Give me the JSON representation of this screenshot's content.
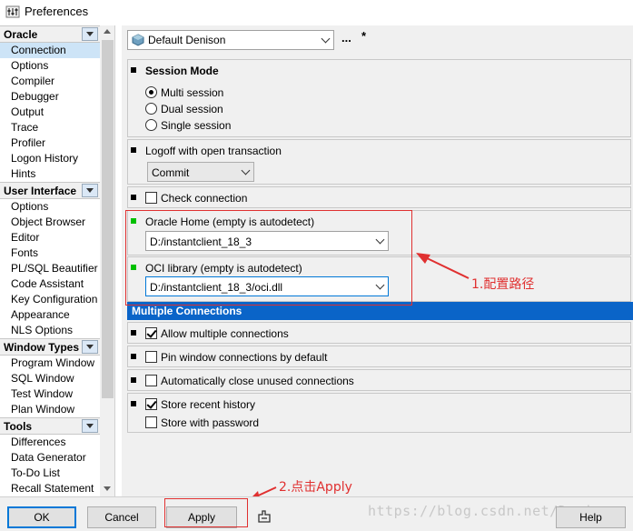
{
  "window": {
    "title": "Preferences"
  },
  "tree": {
    "groups": [
      {
        "label": "Oracle",
        "items": [
          "Connection",
          "Options",
          "Compiler",
          "Debugger",
          "Output",
          "Trace",
          "Profiler",
          "Logon History",
          "Hints"
        ]
      },
      {
        "label": "User Interface",
        "items": [
          "Options",
          "Object Browser",
          "Editor",
          "Fonts",
          "PL/SQL Beautifier",
          "Code Assistant",
          "Key Configuration",
          "Appearance",
          "NLS Options"
        ]
      },
      {
        "label": "Window Types",
        "items": [
          "Program Window",
          "SQL Window",
          "Test Window",
          "Plan Window"
        ]
      },
      {
        "label": "Tools",
        "items": [
          "Differences",
          "Data Generator",
          "To-Do List",
          "Recall Statement"
        ]
      }
    ],
    "selected": "Connection"
  },
  "top": {
    "preference_set": "Default Denison",
    "dots": "...",
    "star": "*"
  },
  "session": {
    "title": "Session Mode",
    "options": [
      "Multi session",
      "Dual session",
      "Single session"
    ],
    "selected": "Multi session"
  },
  "logoff": {
    "title": "Logoff with open transaction",
    "value": "Commit"
  },
  "check_connection": {
    "label": "Check connection",
    "checked": false
  },
  "oracle_home": {
    "title": "Oracle Home (empty is autodetect)",
    "value": "D:/instantclient_18_3"
  },
  "oci_library": {
    "title": "OCI library (empty is autodetect)",
    "value": "D:/instantclient_18_3/oci.dll"
  },
  "multiple_connections": {
    "title": "Multiple Connections",
    "allow": {
      "label": "Allow multiple connections",
      "checked": true
    },
    "pin": {
      "label": "Pin window connections by default",
      "checked": false
    },
    "auto_close": {
      "label": "Automatically close unused connections",
      "checked": false
    },
    "store_history": {
      "label": "Store recent history",
      "checked": true
    },
    "store_password": {
      "label": "Store with password",
      "checked": false
    }
  },
  "annotations": {
    "path_note": "1.配置路径",
    "apply_note": "2.点击Apply",
    "color": "#e03030"
  },
  "buttons": {
    "ok": "OK",
    "cancel": "Cancel",
    "apply": "Apply",
    "help": "Help"
  },
  "watermark": "https://blog.csdn.net/Denison"
}
